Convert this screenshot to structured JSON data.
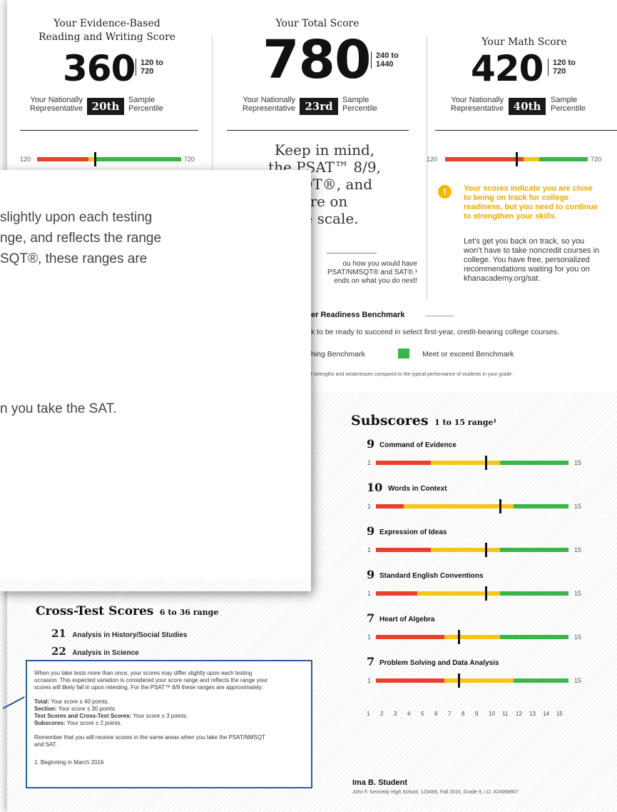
{
  "columns": {
    "rw": {
      "title_line1": "Your Evidence-Based",
      "title_line2": "Reading and Writing Score",
      "score": "360",
      "range_line1": "120 to",
      "range_line2": "720",
      "pct_left_1": "Your Nationally",
      "pct_left_2": "Representative",
      "percentile": "20th",
      "pct_right_1": "Sample",
      "pct_right_2": "Percentile",
      "bar_min": "120",
      "bar_max": "720",
      "score_fraction": 0.4
    },
    "total": {
      "title": "Your Total Score",
      "score": "780",
      "range_line1": "240 to",
      "range_line2": "1440",
      "pct_left_1": "Your Nationally",
      "pct_left_2": "Representative",
      "percentile": "23rd",
      "pct_right_1": "Sample",
      "pct_right_2": "Percentile",
      "keep_line1": "Keep in mind,",
      "keep_line2": "the PSAT™ 8/9,",
      "keep_line3": "MSQT®, and",
      "keep_line4": "are on",
      "keep_line5": "me scale.",
      "small_line1": "ou how you would have",
      "small_line2": "PSAT/NMSQT® and SAT®.¹",
      "small_line3": "ends on what you do next!"
    },
    "math": {
      "title": "Your Math Score",
      "score": "420",
      "range_line1": "120 to",
      "range_line2": "720",
      "pct_left_1": "Your Nationally",
      "pct_left_2": "Representative",
      "percentile": "40th",
      "pct_right_1": "Sample",
      "pct_right_2": "Percentile",
      "bar_min": "120",
      "bar_max": "720",
      "score_fraction": 0.5,
      "alert_icon": "!",
      "alert_line1": "Your scores indicate you are close",
      "alert_line2": "to being on track for college",
      "alert_line3": "readiness, but you need to continue",
      "alert_line4": "to strengthen your skills.",
      "advice_line1": "Let’s get you back on track, so you",
      "advice_line2": "won’t have to take noncredit courses in",
      "advice_line3": "college. You have free, personalized",
      "advice_line4": "recommendations waiting for you on",
      "advice_line5": "khanacademy.org/sat."
    }
  },
  "benchmark": {
    "title": "er Readiness Benchmark",
    "desc": "k to be ready to succeed in select first-year, credit-bearing college courses.",
    "legend_approaching": "hing Benchmark",
    "legend_meet": "Meet or exceed Benchmark",
    "note": "f strengths and weaknesses compared to the typical performance of students in your grade."
  },
  "subscores": {
    "title": "Subscores",
    "range": "1 to 15 range¹",
    "min": "1",
    "max": "15",
    "items": [
      {
        "score": "9",
        "name": "Command of Evidence",
        "value": 9,
        "red_to": 5,
        "yel_to": 10
      },
      {
        "score": "10",
        "name": "Words in Context",
        "value": 10,
        "red_to": 3,
        "yel_to": 11
      },
      {
        "score": "9",
        "name": "Expression of Ideas",
        "value": 9,
        "red_to": 5,
        "yel_to": 10
      },
      {
        "score": "9",
        "name": "Standard English Conventions",
        "value": 9,
        "red_to": 4,
        "yel_to": 10
      },
      {
        "score": "7",
        "name": "Heart of Algebra",
        "value": 7,
        "red_to": 6,
        "yel_to": 10
      },
      {
        "score": "7",
        "name": "Problem Solving and Data Analysis",
        "value": 7,
        "red_to": 6,
        "yel_to": 11
      }
    ],
    "axis": [
      "1",
      "2",
      "3",
      "4",
      "5",
      "6",
      "7",
      "8",
      "9",
      "10",
      "11",
      "12",
      "13",
      "14",
      "15"
    ]
  },
  "cross_test": {
    "title": "Cross-Test Scores",
    "range": "6 to 36 range",
    "items": [
      {
        "score": "21",
        "name": "Analysis in History/Social Studies"
      },
      {
        "score": "22",
        "name": "Analysis in Science"
      }
    ]
  },
  "footnote_box": {
    "p1_l1": "When you take tests more than once, your scores may differ slightly upon each testing",
    "p1_l2": "occasion. This expected variation is considered your score range and reflects the range your",
    "p1_l3": "scores will likely fall in upon retesting. For the PSAT™ 8/9 these ranges are approximately:",
    "total_label": "Total:",
    "total_val": "Your score ± 40 points.",
    "section_label": "Section:",
    "section_val": "Your score ± 30 points.",
    "test_label": "Test Scores and Cross-Test Scores:",
    "test_val": "Your score ± 3 points.",
    "sub_label": "Subscores:",
    "sub_val": "Your score ± 2 points.",
    "p2_l1": "Remember that you will receive scores in the same areas when you take the PSAT/NMSQT",
    "p2_l2": "and SAT.",
    "foot": "1. Beginning in March 2016"
  },
  "student": {
    "name": "Ima B. Student",
    "details": "John F. Kennedy High School, 123456, Fall 2015, Grade 9, I.D. #24068907"
  },
  "overlay": {
    "line1": "slightly upon each testing",
    "line2": "nge, and reflects the range",
    "line3": "SQT®, these ranges are",
    "line4": "n you take the SAT."
  }
}
